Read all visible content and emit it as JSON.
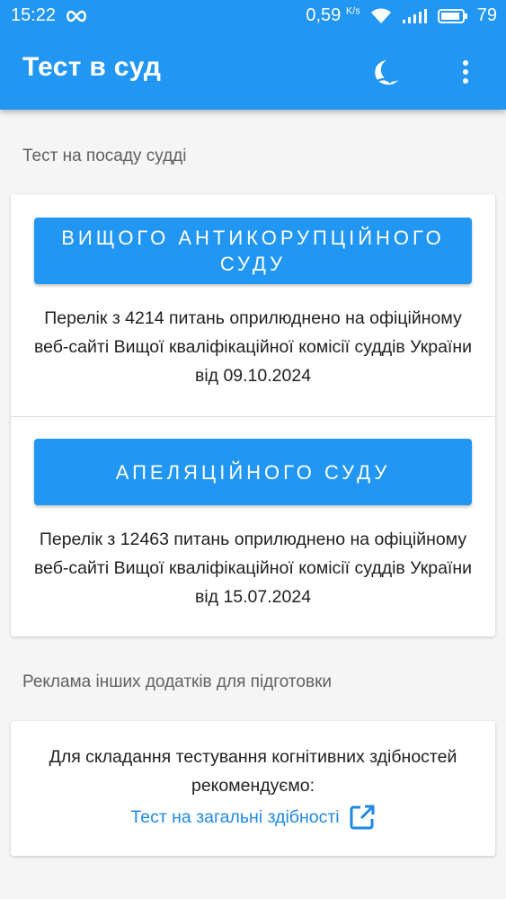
{
  "status_bar": {
    "time": "15:22",
    "speed_value": "0,59",
    "speed_unit": "K/s",
    "battery": "79"
  },
  "app_bar": {
    "title": "Тест в суд",
    "night_mode_icon": "moon-icon",
    "menu_icon": "more-vert-icon"
  },
  "test_section": {
    "label": "Тест на посаду судді",
    "courts": [
      {
        "button_label": "ВИЩОГО АНТИКОРУПЦІЙНОГО СУДУ",
        "description": "Перелік з 4214 питань оприлюднено на офіційному веб-сайті Вищої кваліфікаційної комісії суддів України від 09.10.2024"
      },
      {
        "button_label": "АПЕЛЯЦІЙНОГО СУДУ",
        "description": "Перелік з 12463 питань оприлюднено на офіційному веб-сайті Вищої кваліфікаційної комісії суддів України від 15.07.2024"
      }
    ]
  },
  "ads_section": {
    "label": "Реклама інших додатків для підготовки",
    "text": "Для складання тестування когнітивних здібностей рекомендуємо:",
    "link_label": "Тест на загальні здібності",
    "link_icon": "open-in-new-icon"
  },
  "colors": {
    "primary": "#2196f3",
    "link": "#1e88e5"
  }
}
